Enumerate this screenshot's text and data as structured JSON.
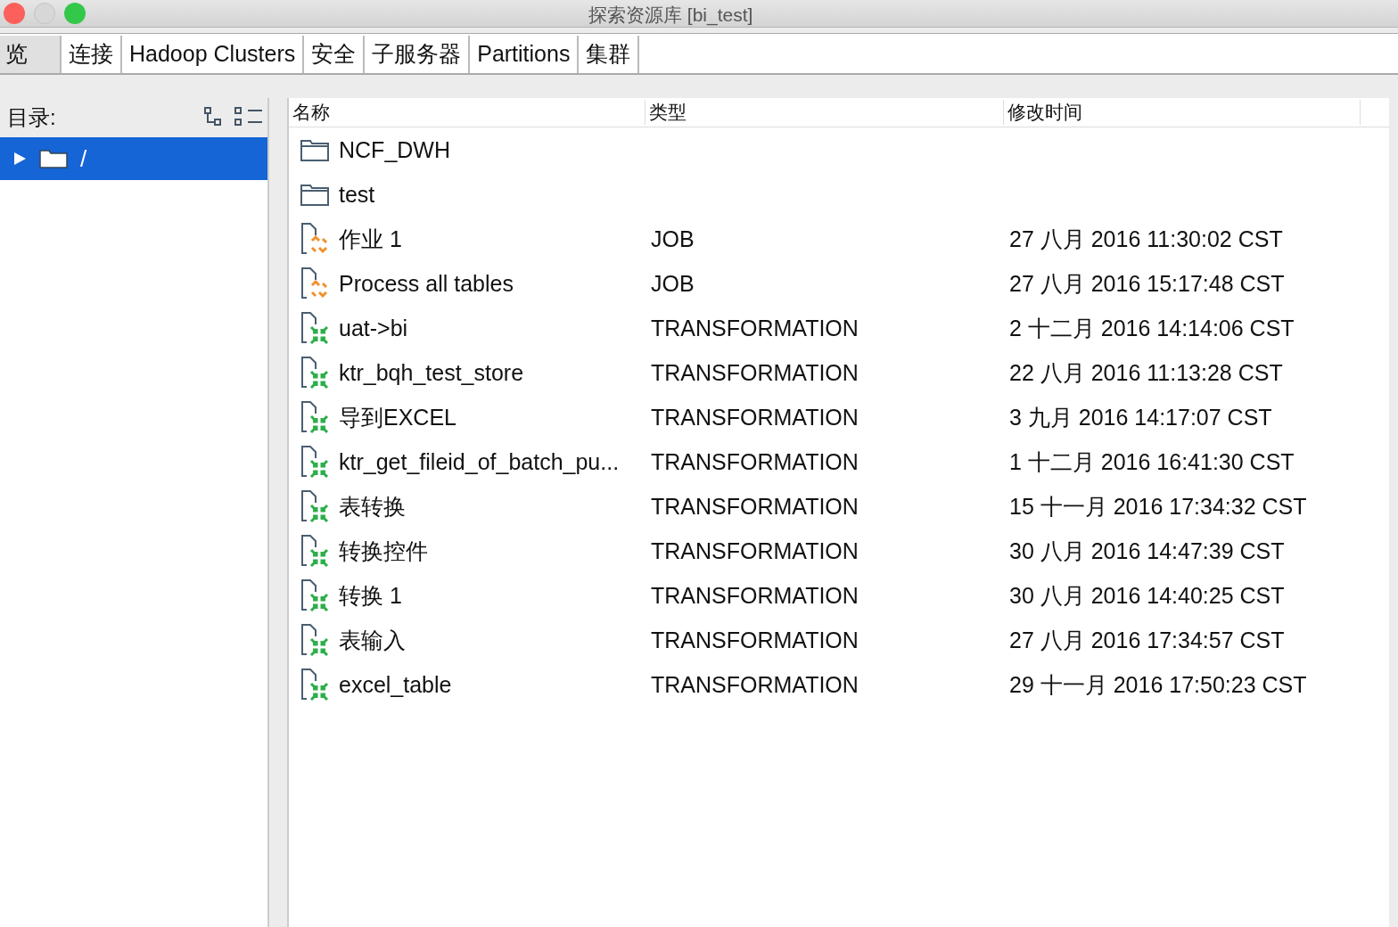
{
  "window": {
    "title": "探索资源库 [bi_test]"
  },
  "tabs": [
    {
      "label": "览",
      "selected": true
    },
    {
      "label": "连接",
      "selected": false
    },
    {
      "label": "Hadoop Clusters",
      "selected": false
    },
    {
      "label": "安全",
      "selected": false
    },
    {
      "label": "子服务器",
      "selected": false
    },
    {
      "label": "Partitions",
      "selected": false
    },
    {
      "label": "集群",
      "selected": false
    }
  ],
  "sidebar": {
    "label": "目录:",
    "items": [
      {
        "label": "/",
        "selected": true,
        "expanded": false
      }
    ]
  },
  "table": {
    "columns": [
      "名称",
      "类型",
      "修改时间"
    ],
    "rows": [
      {
        "kind": "folder",
        "name": "NCF_DWH"
      },
      {
        "kind": "folder",
        "name": "test"
      },
      {
        "kind": "job",
        "name": "作业 1",
        "type": "JOB",
        "modified": "27 八月 2016 11:30:02 CST"
      },
      {
        "kind": "job",
        "name": "Process all tables",
        "type": "JOB",
        "modified": "27 八月 2016 15:17:48 CST"
      },
      {
        "kind": "transformation",
        "name": "uat->bi",
        "type": "TRANSFORMATION",
        "modified": "2 十二月 2016 14:14:06 CST"
      },
      {
        "kind": "transformation",
        "name": "ktr_bqh_test_store",
        "type": "TRANSFORMATION",
        "modified": "22 八月 2016 11:13:28 CST"
      },
      {
        "kind": "transformation",
        "name": "导到EXCEL",
        "type": "TRANSFORMATION",
        "modified": "3 九月 2016 14:17:07 CST"
      },
      {
        "kind": "transformation",
        "name": "ktr_get_fileid_of_batch_pu...",
        "type": "TRANSFORMATION",
        "modified": "1 十二月 2016 16:41:30 CST"
      },
      {
        "kind": "transformation",
        "name": "表转换",
        "type": "TRANSFORMATION",
        "modified": "15 十一月 2016 17:34:32 CST"
      },
      {
        "kind": "transformation",
        "name": "转换控件",
        "type": "TRANSFORMATION",
        "modified": "30 八月 2016 14:47:39 CST"
      },
      {
        "kind": "transformation",
        "name": "转换 1",
        "type": "TRANSFORMATION",
        "modified": "30 八月 2016 14:40:25 CST"
      },
      {
        "kind": "transformation",
        "name": "表输入",
        "type": "TRANSFORMATION",
        "modified": "27 八月 2016 17:34:57 CST"
      },
      {
        "kind": "transformation",
        "name": "excel_table",
        "type": "TRANSFORMATION",
        "modified": "29 十一月 2016 17:50:23 CST"
      }
    ]
  }
}
